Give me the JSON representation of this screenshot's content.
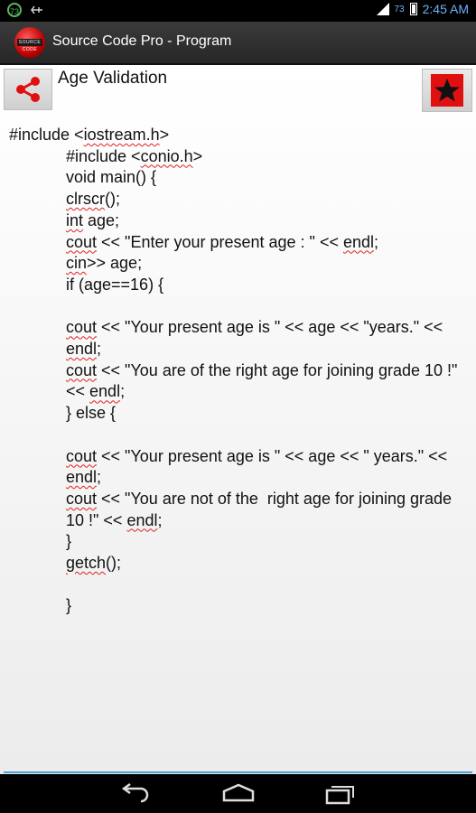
{
  "status_bar": {
    "notification_count": "73",
    "battery_level": "73",
    "time": "2:45 AM"
  },
  "action_bar": {
    "logo_text": "SOURCE CODE",
    "title": "Source Code Pro - Program"
  },
  "program": {
    "title": "Age Validation",
    "code_lines": [
      "#include <iostream.h>",
      "#include <conio.h>",
      "void main() {",
      "clrscr();",
      "int age;",
      "cout << \"Enter your present age : \" << endl;",
      "cin>> age;",
      "if (age==16) {",
      "",
      "cout << \"Your present age is \" << age << \"years.\" << endl;",
      "cout << \"You are of the right age for joining grade 10 !\" << endl;",
      "} else {",
      "",
      "cout << \"Your present age is \" << age << \" years.\" << endl;",
      "cout << \"You are not of the  right age for joining grade 10 !\" << endl;",
      "}",
      "getch();",
      "",
      "}"
    ]
  },
  "icons": {
    "share": "share-icon",
    "favorite": "star-icon",
    "back": "back-icon",
    "home": "home-icon",
    "recents": "recents-icon"
  },
  "colors": {
    "accent": "#4aa3d8",
    "favorite": "#e01010",
    "spellcheck": "#e02020"
  }
}
